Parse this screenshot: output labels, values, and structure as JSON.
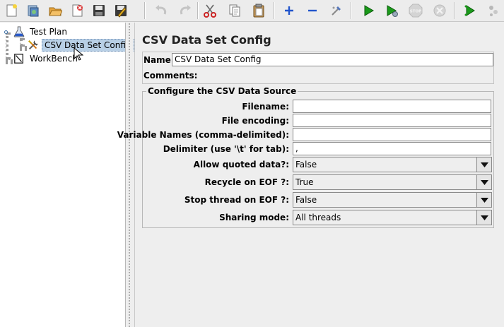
{
  "toolbar": {
    "buttons": [
      {
        "name": "new-icon",
        "enabled": true
      },
      {
        "name": "templates-icon",
        "enabled": true
      },
      {
        "name": "open-icon",
        "enabled": true
      },
      {
        "name": "close-file-icon",
        "enabled": true
      },
      {
        "name": "save-icon",
        "enabled": true
      },
      {
        "name": "save-snippet-icon",
        "enabled": true
      },
      {
        "name": "undo-icon",
        "enabled": false
      },
      {
        "name": "redo-icon",
        "enabled": false
      },
      {
        "name": "cut-icon",
        "enabled": true
      },
      {
        "name": "copy-icon",
        "enabled": true
      },
      {
        "name": "paste-icon",
        "enabled": true
      },
      {
        "name": "expand-icon",
        "enabled": true
      },
      {
        "name": "collapse-icon",
        "enabled": true
      },
      {
        "name": "toggle-icon",
        "enabled": true
      },
      {
        "name": "start-icon",
        "enabled": true
      },
      {
        "name": "start-no-pause-icon",
        "enabled": true
      },
      {
        "name": "stop-icon",
        "enabled": false
      },
      {
        "name": "shutdown-icon",
        "enabled": false
      },
      {
        "name": "remote-start-icon",
        "enabled": true
      },
      {
        "name": "remote-start-all-icon",
        "enabled": true
      }
    ],
    "stop_label": "STOP"
  },
  "tree": {
    "items": [
      {
        "label": "Test Plan",
        "icon": "test-plan-icon"
      },
      {
        "label": "CSV Data Set Config",
        "icon": "config-element-icon",
        "selected": true
      },
      {
        "label": "WorkBench",
        "icon": "workbench-icon"
      }
    ]
  },
  "panel": {
    "title": "CSV Data Set Config",
    "name_label": "Name:",
    "name_value": "CSV Data Set Config",
    "comments_label": "Comments:",
    "group_title": "Configure the CSV Data Source",
    "fields": [
      {
        "label": "Filename:",
        "value": ""
      },
      {
        "label": "File encoding:",
        "value": ""
      },
      {
        "label": "Variable Names (comma-delimited):",
        "value": ""
      },
      {
        "label": "Delimiter (use '\\t' for tab):",
        "value": ","
      }
    ],
    "combos": [
      {
        "label": "Allow quoted data?:",
        "value": "False"
      },
      {
        "label": "Recycle on EOF ?:",
        "value": "True"
      },
      {
        "label": "Stop thread on EOF ?:",
        "value": "False"
      },
      {
        "label": "Sharing mode:",
        "value": "All threads"
      }
    ]
  },
  "colors": {
    "selection": "#b8cfe5",
    "run_green": "#1a9a1a",
    "cut_red": "#cc2222",
    "add_blue": "#2255cc"
  }
}
